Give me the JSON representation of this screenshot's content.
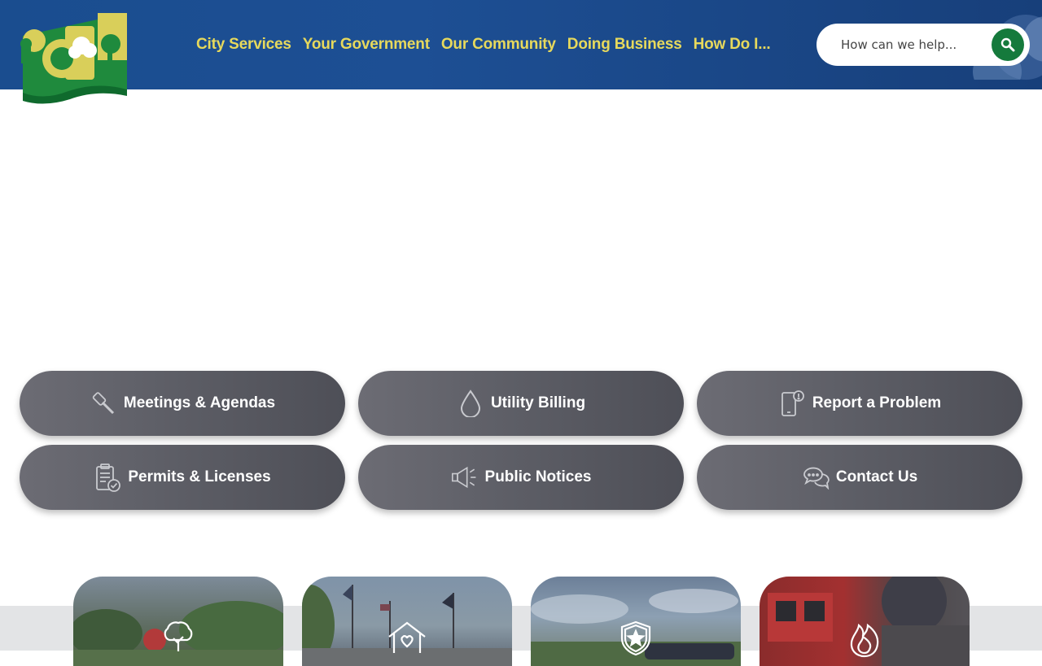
{
  "nav": {
    "items": [
      "City Services",
      "Your Government",
      "Our Community",
      "Doing Business",
      "How Do I..."
    ]
  },
  "search": {
    "placeholder": "How can we help..."
  },
  "quick_links": [
    {
      "label": "Meetings & Agendas",
      "icon": "gavel-icon"
    },
    {
      "label": "Utility Billing",
      "icon": "water-drop-icon"
    },
    {
      "label": "Report a Problem",
      "icon": "phone-alert-icon"
    },
    {
      "label": "Permits & Licenses",
      "icon": "clipboard-check-icon"
    },
    {
      "label": "Public Notices",
      "icon": "megaphone-icon"
    },
    {
      "label": "Contact Us",
      "icon": "chat-bubbles-icon"
    }
  ],
  "cards": [
    {
      "icon": "tree-icon"
    },
    {
      "icon": "house-heart-icon"
    },
    {
      "icon": "police-badge-icon"
    },
    {
      "icon": "flame-icon"
    }
  ],
  "colors": {
    "header": "#1d4f94",
    "nav_text": "#e7d95c",
    "search_button": "#157a3c",
    "quick_link_bg": "#5c5d65"
  }
}
